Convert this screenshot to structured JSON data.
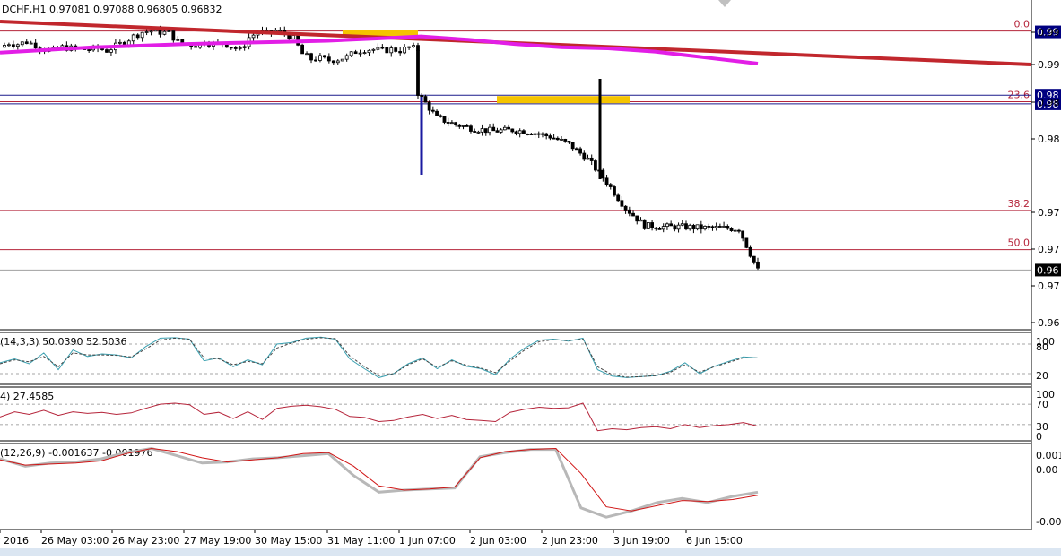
{
  "header": {
    "text": "DCHF,H1  0.97081 0.97088 0.96805 0.96832"
  },
  "colors": {
    "trendline": "#c1272d",
    "moving_average": "#e21ee6",
    "fib_line": "#b5243a",
    "hline": "#1a1a8c",
    "zone": "#f5c400",
    "candle": "#000000",
    "stoch_main": "#3aa0b0",
    "rsi": "#b5243a",
    "macd_main": "#b8b8b8",
    "macd_signal": "#d01515",
    "price_box": "#000080",
    "current_box": "#000000"
  },
  "chart_data": [
    {
      "type": "candlestick",
      "title": "DCHF,H1  0.97081 0.97088 0.96805 0.96832",
      "symbol": "DCHF",
      "timeframe": "H1",
      "last_bar": {
        "open": 0.97081,
        "high": 0.97088,
        "low": 0.96805,
        "close": 0.96832
      },
      "ylim": [
        0.963,
        0.9915
      ],
      "y_ticks": [
        "0.99",
        "0.99",
        "0.98",
        "0.98",
        "0.97",
        "0.97",
        "0.97",
        "0.96"
      ],
      "x_ticks": [
        "y 2016",
        "26 May 03:00",
        "26 May 23:00",
        "27 May 19:00",
        "30 May 15:00",
        "31 May 11:00",
        "1 Jun 07:00",
        "2 Jun 03:00",
        "2 Jun 23:00",
        "3 Jun 19:00",
        "6 Jun 15:00"
      ],
      "fibonacci_levels": [
        {
          "label": "0.0",
          "price": 0.9903
        },
        {
          "label": "23.6",
          "price": 0.9838
        },
        {
          "label": "38.2",
          "price": 0.9738
        },
        {
          "label": "50.0",
          "price": 0.9702
        }
      ],
      "horizontal_lines": [
        {
          "label": "0.98",
          "price": 0.9844
        },
        {
          "label": "0.98",
          "price": 0.9836
        }
      ],
      "current_price_label": "0.96",
      "top_price_label": "0.99",
      "series": [
        {
          "type": "trendline",
          "points": [
            [
              0,
              0.9912
            ],
            [
              210,
              0.9885
            ]
          ]
        },
        {
          "type": "moving_average",
          "x": [
            0,
            20,
            40,
            60,
            70,
            80,
            90,
            100,
            110,
            120,
            130,
            140,
            150,
            162
          ],
          "values": [
            0.9883,
            0.9888,
            0.9891,
            0.9893,
            0.9894,
            0.9896,
            0.9898,
            0.9895,
            0.9891,
            0.9888,
            0.9887,
            0.9884,
            0.9879,
            0.9873
          ]
        },
        {
          "type": "candles",
          "x_range": [
            0,
            162
          ],
          "close": [
            0.9888,
            0.9892,
            0.9891,
            0.9893,
            0.989,
            0.9886,
            0.9885,
            0.9888,
            0.9887,
            0.9886,
            0.9886,
            0.9887,
            0.9885,
            0.9889,
            0.9893,
            0.9898,
            0.9902,
            0.9903,
            0.9902,
            0.9901,
            0.9893,
            0.9891,
            0.989,
            0.9893,
            0.9891,
            0.9892,
            0.9889,
            0.9885,
            0.9897,
            0.9902,
            0.9901,
            0.9903,
            0.9901,
            0.9896,
            0.9882,
            0.9877,
            0.9878,
            0.9876,
            0.9877,
            0.9879,
            0.9884,
            0.9886,
            0.9886,
            0.9885,
            0.9886,
            0.9885,
            0.9888,
            0.9886,
            0.9846,
            0.9823,
            0.9817,
            0.9813,
            0.9811,
            0.9812,
            0.981,
            0.9806,
            0.9799,
            0.9785,
            0.9764,
            0.974,
            0.9724,
            0.9723,
            0.9723,
            0.9722,
            0.9722,
            0.9721,
            0.9683
          ]
        }
      ]
    },
    {
      "type": "line",
      "title": "(14,3,3) 50.0390 52.5036",
      "ylim": [
        0,
        100
      ],
      "y_ticks": [
        "100",
        "80",
        "20"
      ],
      "series": [
        {
          "name": "main",
          "values": [
            42,
            50,
            40,
            62,
            28,
            68,
            55,
            60,
            58,
            52,
            75,
            92,
            93,
            90,
            46,
            52,
            34,
            48,
            38,
            80,
            83,
            92,
            94,
            90,
            50,
            30,
            12,
            20,
            40,
            52,
            30,
            48,
            35,
            30,
            18,
            50,
            72,
            88,
            90,
            86,
            92,
            28,
            15,
            12,
            14,
            16,
            25,
            42,
            20,
            35,
            45,
            54,
            52
          ]
        },
        {
          "name": "signal",
          "values": [
            40,
            48,
            44,
            55,
            34,
            62,
            58,
            58,
            57,
            54,
            70,
            88,
            92,
            90,
            52,
            50,
            38,
            45,
            40,
            72,
            82,
            90,
            93,
            91,
            56,
            34,
            16,
            20,
            38,
            50,
            33,
            46,
            37,
            31,
            22,
            46,
            68,
            85,
            89,
            87,
            90,
            34,
            18,
            13,
            14,
            16,
            23,
            38,
            23,
            34,
            43,
            52,
            52
          ]
        }
      ]
    },
    {
      "type": "line",
      "title": "4) 27.4585",
      "ylim": [
        0,
        100
      ],
      "y_ticks": [
        "100",
        "70",
        "30",
        "0"
      ],
      "series": [
        {
          "name": "RSI",
          "values": [
            45,
            55,
            50,
            58,
            48,
            55,
            52,
            54,
            50,
            53,
            62,
            70,
            72,
            69,
            50,
            54,
            42,
            55,
            40,
            62,
            66,
            68,
            65,
            60,
            46,
            44,
            36,
            38,
            45,
            50,
            42,
            48,
            40,
            38,
            36,
            54,
            60,
            64,
            62,
            63,
            72,
            18,
            22,
            20,
            24,
            26,
            22,
            30,
            24,
            28,
            30,
            34,
            27
          ]
        }
      ]
    },
    {
      "type": "line",
      "title": "(12,26,9) -0.001637 -0.001976",
      "ylim": [
        -0.0065,
        0.0015
      ],
      "y_ticks": [
        "0.001",
        "0.00",
        "-0.00"
      ],
      "series": [
        {
          "name": "MACD",
          "values": [
            0.0002,
            -0.0005,
            -0.0002,
            -0.0001,
            0.0002,
            0.0008,
            0.0012,
            0.0005,
            -0.0002,
            -0.0001,
            0.0002,
            0.0003,
            0.0005,
            0.0007,
            -0.0014,
            -0.003,
            -0.0028,
            -0.0027,
            -0.0026,
            0.0004,
            0.0008,
            0.0011,
            0.0011,
            -0.0045,
            -0.0054,
            -0.0048,
            -0.004,
            -0.0036,
            -0.004,
            -0.0034,
            -0.003
          ]
        },
        {
          "name": "Signal",
          "values": [
            0.0001,
            -0.0004,
            -0.0003,
            -0.0002,
            0.0,
            0.0007,
            0.0012,
            0.0009,
            0.0003,
            -0.0001,
            0.0001,
            0.0003,
            0.0007,
            0.0008,
            -0.0005,
            -0.0024,
            -0.0028,
            -0.0027,
            -0.0025,
            0.0003,
            0.0009,
            0.0011,
            0.0012,
            -0.0012,
            -0.0044,
            -0.0048,
            -0.0043,
            -0.0038,
            -0.0039,
            -0.0037,
            -0.0033
          ]
        }
      ]
    }
  ]
}
